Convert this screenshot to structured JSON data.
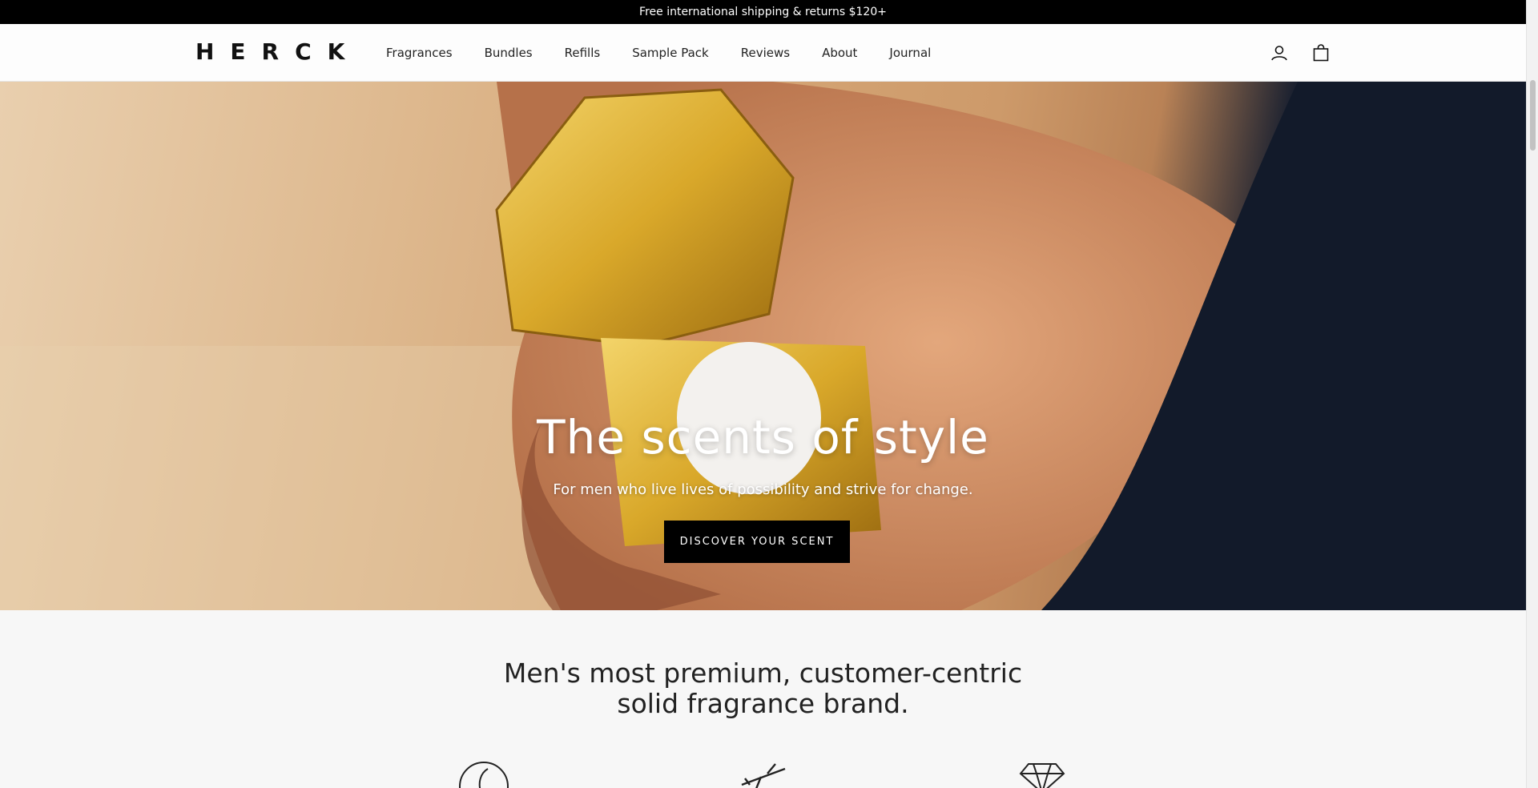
{
  "announcement": "Free international shipping & returns $120+",
  "brand": "HERCK",
  "nav": [
    "Fragrances",
    "Bundles",
    "Refills",
    "Sample Pack",
    "Reviews",
    "About",
    "Journal"
  ],
  "header_icons": [
    "account-icon",
    "cart-icon"
  ],
  "hero": {
    "title": "The scents of style",
    "subtitle": "For men who live lives of possibility and strive for change.",
    "cta": "DISCOVER YOUR SCENT"
  },
  "tagline": {
    "line1": "Men's most premium, customer-centric",
    "line2": "solid fragrance brand."
  },
  "feature_icons": [
    "feather-icon",
    "airplane-icon",
    "diamond-icon"
  ]
}
